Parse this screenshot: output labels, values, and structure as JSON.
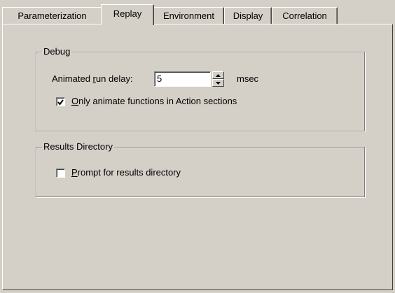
{
  "tabs": [
    {
      "label": "Parameterization",
      "active": false
    },
    {
      "label": "Replay",
      "active": true
    },
    {
      "label": "Environment",
      "active": false
    },
    {
      "label": "Display",
      "active": false
    },
    {
      "label": "Correlation",
      "active": false
    }
  ],
  "debug": {
    "group_label": "Debug",
    "run_delay_label_pre": "Animated ",
    "run_delay_label_accel": "r",
    "run_delay_label_post": "un delay:",
    "run_delay_value": "5",
    "run_delay_unit": "msec",
    "animate_accel": "O",
    "animate_label": "nly animate functions in Action sections",
    "animate_checked": true
  },
  "results": {
    "group_label": "Results Directory",
    "prompt_accel": "P",
    "prompt_label": "rompt for results directory",
    "prompt_checked": false
  }
}
